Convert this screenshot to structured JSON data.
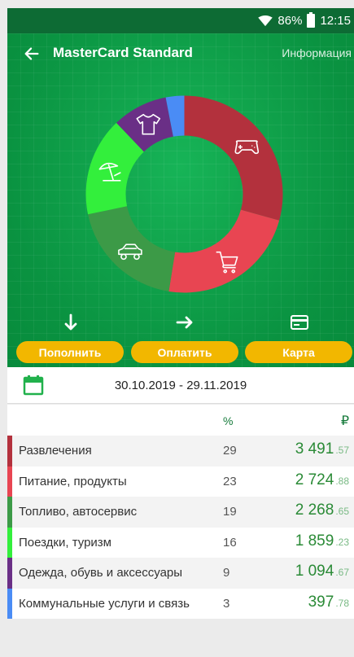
{
  "status": {
    "battery": "86%",
    "time": "12:15"
  },
  "header": {
    "title": "MasterCard Standard",
    "info_link": "Информация"
  },
  "donut": {
    "segments": [
      {
        "category": "Развлечения",
        "percent": 29,
        "color": "#b3313d",
        "icon": "gamepad-icon"
      },
      {
        "category": "Питание, продукты",
        "percent": 23,
        "color": "#e84552",
        "icon": "shopping-cart-icon"
      },
      {
        "category": "Топливо, автосервис",
        "percent": 19,
        "color": "#3c9a47",
        "icon": "car-icon"
      },
      {
        "category": "Поездки, туризм",
        "percent": 16,
        "color": "#33ef3c",
        "icon": "beach-umbrella-icon"
      },
      {
        "category": "Одежда, обувь и аксессуары",
        "percent": 9,
        "color": "#6a2f86",
        "icon": "tshirt-icon"
      },
      {
        "category": "Коммунальные услуги и связь",
        "percent": 3,
        "color": "#4a8cf5",
        "icon": ""
      }
    ]
  },
  "actions": {
    "topup": {
      "label": "Пополнить",
      "icon": "arrow-down-icon"
    },
    "pay": {
      "label": "Оплатить",
      "icon": "arrow-right-icon"
    },
    "card": {
      "label": "Карта",
      "icon": "card-icon"
    }
  },
  "period": {
    "range": "30.10.2019 - 29.11.2019",
    "icon": "calendar-icon"
  },
  "table": {
    "col_percent": "%",
    "col_amount": "₽",
    "rows": [
      {
        "name": "Развлечения",
        "percent": "29",
        "amount_int": "3 491",
        "amount_dec": ".57",
        "color": "#b3313d"
      },
      {
        "name": "Питание, продукты",
        "percent": "23",
        "amount_int": "2 724",
        "amount_dec": ".88",
        "color": "#e84552"
      },
      {
        "name": "Топливо, автосервис",
        "percent": "19",
        "amount_int": "2 268",
        "amount_dec": ".65",
        "color": "#3c9a47"
      },
      {
        "name": "Поездки, туризм",
        "percent": "16",
        "amount_int": "1 859",
        "amount_dec": ".23",
        "color": "#33ef3c"
      },
      {
        "name": "Одежда, обувь и аксессуары",
        "percent": "9",
        "amount_int": "1 094",
        "amount_dec": ".67",
        "color": "#6a2f86"
      },
      {
        "name": "Коммунальные услуги и связь",
        "percent": "3",
        "amount_int": "397",
        "amount_dec": ".78",
        "color": "#4a8cf5"
      }
    ]
  }
}
